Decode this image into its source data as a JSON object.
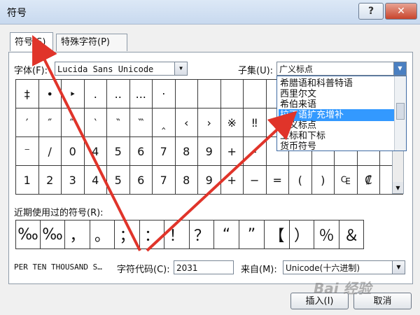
{
  "window": {
    "title": "符号",
    "help": "?",
    "close": "✕"
  },
  "tabs": [
    "符号(S)",
    "特殊字符(P)"
  ],
  "font": {
    "label": "字体(F):",
    "value": "Lucida Sans Unicode"
  },
  "subset": {
    "label": "子集(U):",
    "value": "广义标点"
  },
  "subset_options": [
    "希腊语和科普特语",
    "西里尔文",
    "希伯来语",
    "拉丁语扩充增补",
    "广义标点",
    "上标和下标",
    "货币符号"
  ],
  "symbol_grid": [
    [
      "‡",
      "•",
      "‣",
      ".",
      "..",
      "...",
      "‧",
      "",
      "",
      "",
      "",
      "",
      "",
      "",
      "",
      "",
      ""
    ],
    [
      "′",
      "″",
      "‴",
      "‵",
      "‶",
      "‷",
      "‸",
      "‹",
      "›",
      "※",
      "‼",
      "",
      "",
      "",
      "",
      "",
      ""
    ],
    [
      "⁻",
      "/",
      "0",
      "4",
      "5",
      "6",
      "7",
      "8",
      "9",
      "+",
      "-",
      "",
      "",
      "",
      "",
      "",
      ""
    ],
    [
      "1",
      "2",
      "3",
      "4",
      "5",
      "6",
      "7",
      "8",
      "9",
      "+",
      "−",
      "=",
      "(",
      ")",
      "₠",
      "₡",
      ""
    ]
  ],
  "recent": {
    "label": "近期使用过的符号(R):",
    "symbols": [
      "‰",
      "‰",
      "，",
      "。",
      "；",
      "：",
      "！",
      "？",
      "“",
      "”",
      "【",
      "）",
      "％",
      "＆"
    ]
  },
  "footer": {
    "char_name": "PER TEN THOUSAND S…",
    "code_label": "字符代码(C):",
    "code_value": "2031",
    "from_label": "来自(M):",
    "from_value": "Unicode(十六进制)",
    "insert": "插入(I)",
    "cancel": "取消"
  },
  "colors": {
    "selection": "#3399ff",
    "arrow": "#e0342a"
  },
  "watermark": "Bai 经验"
}
